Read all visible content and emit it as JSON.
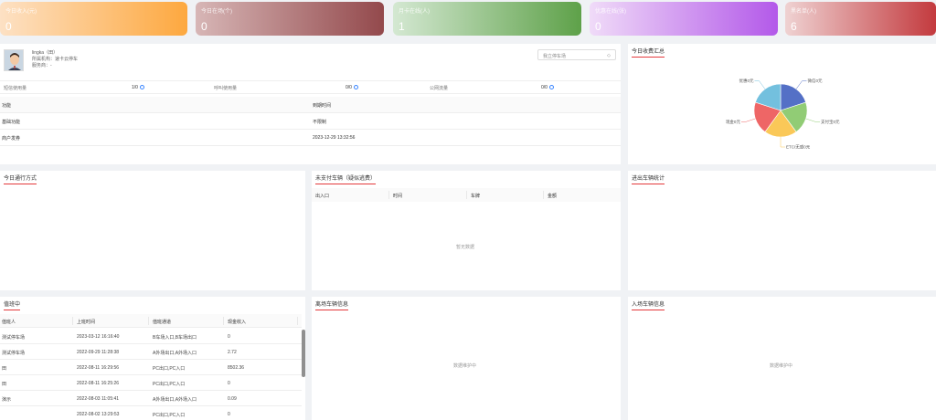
{
  "stats": [
    {
      "label": "今日收入(元)",
      "value": "0"
    },
    {
      "label": "今日在场(个)",
      "value": "0"
    },
    {
      "label": "月卡在线(人)",
      "value": "1"
    },
    {
      "label": "优惠在线(张)",
      "value": "0"
    },
    {
      "label": "黑名单(人)",
      "value": "6"
    }
  ],
  "profile": {
    "name": "lingka（田）",
    "line1": "所属机构：速卡云停车",
    "line2": "服务商：-",
    "parking_select": "我立停车场",
    "usage": [
      {
        "label": "短信使用量",
        "value": "1/0"
      },
      {
        "label": "呼叫使用量",
        "value": "0/0"
      },
      {
        "label": "公网流量",
        "value": "0/0"
      }
    ],
    "feature_headers": [
      "功能",
      "到期时间"
    ],
    "features": [
      {
        "name": "基础功能",
        "expire": "不限制"
      },
      {
        "name": "商户发券",
        "expire": "2023-12-29 13:32:56"
      }
    ]
  },
  "pie": {
    "title": "今日收费汇总",
    "labels": [
      "微信0元",
      "支付宝0元",
      "ETC/无感0元",
      "现金0元",
      "优惠0元"
    ]
  },
  "chart_data": {
    "type": "pie",
    "title": "今日收费汇总",
    "categories": [
      "微信",
      "支付宝",
      "ETC/无感",
      "现金",
      "优惠"
    ],
    "values": [
      0,
      0,
      0,
      0,
      0
    ],
    "colors": [
      "#5470c6",
      "#91cc75",
      "#fac858",
      "#ee6666",
      "#73c0de"
    ]
  },
  "mode": {
    "title": "今日通行方式"
  },
  "unpaid": {
    "title": "未支付车辆（疑似逃费）",
    "headers": [
      "出入口",
      "时间",
      "车牌",
      "金额"
    ],
    "empty": "暂无数据"
  },
  "inout": {
    "title": "进出车辆统计"
  },
  "duty": {
    "title": "值班中",
    "headers": [
      "值班人",
      "上班时间",
      "值班通道",
      "现金收入"
    ],
    "rows": [
      [
        "测试停车场",
        "2023-03-12 16:16:40",
        "B车场入口,B车场出口",
        "0"
      ],
      [
        "测试停车场",
        "2022-09-29 11:28:38",
        "A外场出口,A外场入口",
        "2.72"
      ],
      [
        "田",
        "2022-08-11 16:29:56",
        "PC出口,PC入口",
        "8502.36"
      ],
      [
        "田",
        "2022-08-11 16:25:26",
        "PC出口,PC入口",
        "0"
      ],
      [
        "演示",
        "2022-08-03 11:05:41",
        "A外场出口,A外场入口",
        "0.09"
      ],
      [
        "",
        "2022-08-02 13:29:53",
        "PC出口,PC入口",
        "0"
      ]
    ]
  },
  "outcar": {
    "title": "离场车辆信息",
    "empty": "数据维护中"
  },
  "incar": {
    "title": "入场车辆信息",
    "empty": "数据维护中"
  }
}
